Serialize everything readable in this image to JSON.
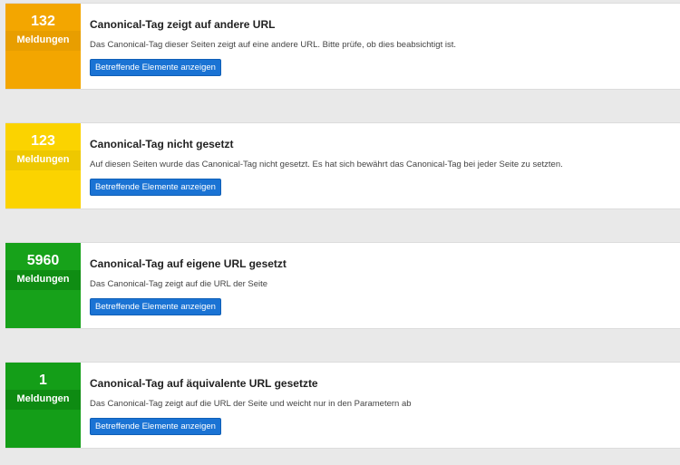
{
  "button_label": "Betreffende Elemente anzeigen",
  "cards": [
    {
      "count": "132",
      "unit": "Meldungen",
      "title": "Canonical-Tag zeigt auf andere URL",
      "description": "Das Canonical-Tag dieser Seiten zeigt auf eine andere URL. Bitte prüfe, ob dies beabsichtigt ist.",
      "color": "#f3a600"
    },
    {
      "count": "123",
      "unit": "Meldungen",
      "title": "Canonical-Tag nicht gesetzt",
      "description": "Auf diesen Seiten wurde das Canonical-Tag nicht gesetzt. Es hat sich bewährt das Canonical-Tag bei jeder Seite zu setzten.",
      "color": "#fbd300"
    },
    {
      "count": "5960",
      "unit": "Meldungen",
      "title": "Canonical-Tag auf eigene URL gesetzt",
      "description": "Das Canonical-Tag zeigt auf die URL der Seite",
      "color": "#17a21a"
    },
    {
      "count": "1",
      "unit": "Meldungen",
      "title": "Canonical-Tag auf äquivalente URL gesetzte",
      "description": "Das Canonical-Tag zeigt auf die URL der Seite und weicht nur in den Parametern ab",
      "color": "#149e18"
    }
  ]
}
